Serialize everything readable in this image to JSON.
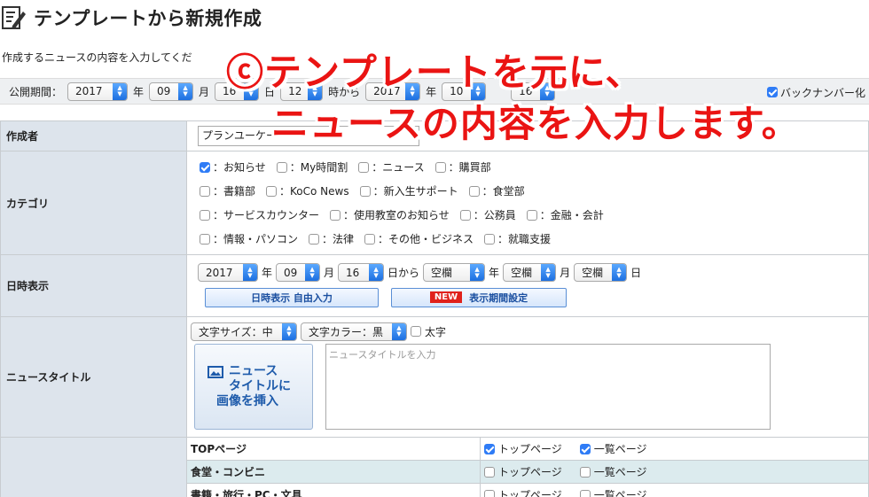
{
  "page": {
    "title": "テンプレートから新規作成",
    "subtitle": "作成するニュースの内容を入力してくだ"
  },
  "period": {
    "label": "公開期間：",
    "start": {
      "year": "2017",
      "year_unit": "年",
      "month": "09",
      "month_unit": "月",
      "day": "16",
      "day_unit": "日"
    },
    "hour": "12",
    "from": "時から",
    "end": {
      "year": "2017",
      "year_unit": "年",
      "month": "10",
      "day": "16"
    },
    "backnumber_label": "バックナンバー化"
  },
  "author": {
    "label": "作成者",
    "value": "プランユーケー"
  },
  "category": {
    "label": "カテゴリ",
    "rows": [
      [
        {
          "text": "：お知らせ",
          "checked": true
        },
        {
          "text": "：My時間割",
          "checked": false
        },
        {
          "text": "：ニュース",
          "checked": false
        },
        {
          "text": "：購買部",
          "checked": false
        }
      ],
      [
        {
          "text": "：書籍部",
          "checked": false
        },
        {
          "text": "：KoCo News",
          "checked": false
        },
        {
          "text": "：新入生サポート",
          "checked": false
        },
        {
          "text": "：食堂部",
          "checked": false
        }
      ],
      [
        {
          "text": "：サービスカウンター",
          "checked": false
        },
        {
          "text": "：使用教室のお知らせ",
          "checked": false
        },
        {
          "text": "：公務員",
          "checked": false
        },
        {
          "text": "：金融・会計",
          "checked": false
        }
      ],
      [
        {
          "text": "：情報・パソコン",
          "checked": false
        },
        {
          "text": "：法律",
          "checked": false
        },
        {
          "text": "：その他・ビジネス",
          "checked": false
        },
        {
          "text": "：就職支援",
          "checked": false
        }
      ]
    ]
  },
  "datetime": {
    "label": "日時表示",
    "year": "2017",
    "year_unit": "年",
    "month": "09",
    "month_unit": "月",
    "day": "16",
    "day_from": "日から",
    "blank1": "空欄",
    "blank_year_unit": "年",
    "blank2": "空欄",
    "blank_month_unit": "月",
    "blank3": "空欄",
    "blank_day_unit": "日",
    "free_input_button": "日時表示 自由入力",
    "new_badge": "NEW",
    "period_button": "表示期間設定"
  },
  "news_title": {
    "label": "ニュースタイトル",
    "font_size": "文字サイズ：中",
    "font_color": "文字カラー：黒",
    "bold": "太字",
    "image_button": [
      "ニュース",
      "タイトルに",
      "画像を挿入"
    ],
    "placeholder": "ニュースタイトルを入力"
  },
  "pages": [
    {
      "name": "TOPページ",
      "top": "トップページ",
      "top_checked": true,
      "list": "一覧ページ",
      "list_checked": true,
      "shaded": false
    },
    {
      "name": "食堂・コンビニ",
      "top": "トップページ",
      "top_checked": false,
      "list": "一覧ページ",
      "list_checked": false,
      "shaded": true
    },
    {
      "name": "書籍・旅行・PC・文具",
      "top": "トップページ",
      "top_checked": false,
      "list": "一覧ページ",
      "list_checked": false,
      "shaded": false
    }
  ],
  "overlay": {
    "line1": "ⓒテンプレートを元に、",
    "line2": "ニュースの内容を入力します。"
  },
  "colors": {
    "accent": "#2f7cf6",
    "overlay_text": "#ea1413",
    "label_bg": "#dde4ec",
    "shaded_row": "#dcebee"
  }
}
